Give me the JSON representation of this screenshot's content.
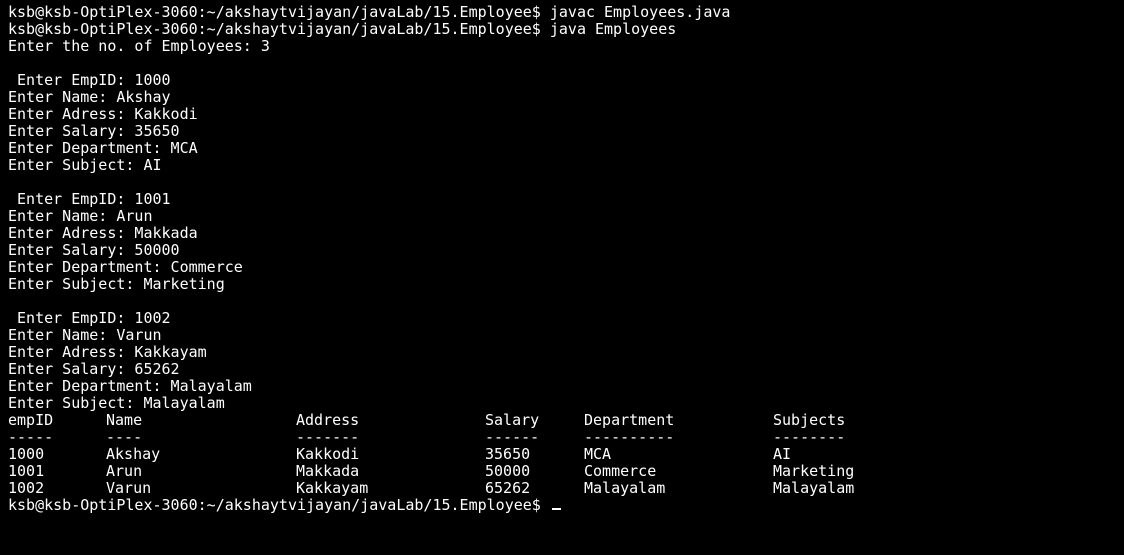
{
  "terminal": {
    "colors": {
      "background": "#000000",
      "foreground": "#ffffff"
    },
    "session": [
      "ksb@ksb-OptiPlex-3060:~/akshaytvijayan/javaLab/15.Employee$ javac Employees.java",
      "ksb@ksb-OptiPlex-3060:~/akshaytvijayan/javaLab/15.Employee$ java Employees",
      "Enter the no. of Employees: 3",
      "",
      " Enter EmpID: 1000",
      "Enter Name: Akshay",
      "Enter Adress: Kakkodi",
      "Enter Salary: 35650",
      "Enter Department: MCA",
      "Enter Subject: AI",
      "",
      " Enter EmpID: 1001",
      "Enter Name: Arun",
      "Enter Adress: Makkada",
      "Enter Salary: 50000",
      "Enter Department: Commerce",
      "Enter Subject: Marketing",
      "",
      " Enter EmpID: 1002",
      "Enter Name: Varun",
      "Enter Adress: Kakkayam",
      "Enter Salary: 65262",
      "Enter Department: Malayalam",
      "Enter Subject: Malayalam"
    ],
    "table": {
      "headers": [
        "empID",
        "Name",
        "Address",
        "Salary",
        "Department",
        "Subjects"
      ],
      "separators": [
        "-----",
        "----",
        "-------",
        "------",
        "----------",
        "--------"
      ],
      "rows": [
        [
          "1000",
          "Akshay",
          "Kakkodi",
          "35650",
          "MCA",
          "AI"
        ],
        [
          "1001",
          "Arun",
          "Makkada",
          "50000",
          "Commerce",
          "Marketing"
        ],
        [
          "1002",
          "Varun",
          "Kakkayam",
          "65262",
          "Malayalam",
          "Malayalam"
        ]
      ]
    },
    "final_prompt": "ksb@ksb-OptiPlex-3060:~/akshaytvijayan/javaLab/15.Employee$ "
  }
}
